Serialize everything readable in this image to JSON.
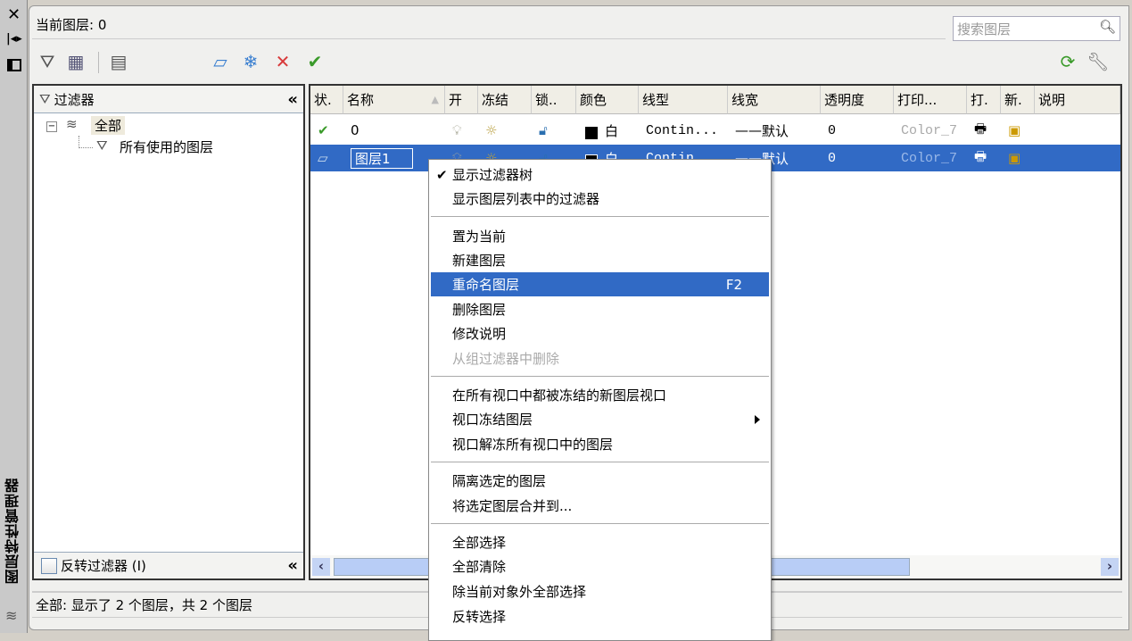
{
  "title": "图层特性管理器",
  "current_layer": "当前图层: 0",
  "search_placeholder": "搜索图层",
  "filter_panel": {
    "title": "过滤器",
    "tree": [
      {
        "label": "全部"
      },
      {
        "label": "所有使用的图层"
      }
    ],
    "invert_label": "反转过滤器 (I)",
    "invert_checked": false
  },
  "columns": [
    "状.",
    "名称",
    "开",
    "冻结",
    "锁..",
    "颜色",
    "线型",
    "线宽",
    "透明度",
    "打印...",
    "打.",
    "新.",
    "说明"
  ],
  "rows": [
    {
      "status": "current",
      "name": "0",
      "color": "白",
      "linetype": "Contin...",
      "lineweight": "默认",
      "transparency": "0",
      "plotstyle": "Color_7",
      "selected": false
    },
    {
      "status": "layer",
      "name": "图层1",
      "color": "白",
      "linetype": "Contin...",
      "lineweight": "默认",
      "transparency": "0",
      "plotstyle": "Color_7",
      "selected": true
    }
  ],
  "status_bar": "全部: 显示了 2 个图层，共 2 个图层",
  "context_menu": {
    "items": [
      {
        "label": "显示过滤器树",
        "checked": true
      },
      {
        "label": "显示图层列表中的过滤器"
      },
      {
        "label": "置为当前"
      },
      {
        "label": "新建图层"
      },
      {
        "label": "重命名图层",
        "shortcut": "F2",
        "highlighted": true
      },
      {
        "label": "删除图层"
      },
      {
        "label": "修改说明"
      },
      {
        "label": "从组过滤器中删除",
        "disabled": true
      },
      {
        "label": "在所有视口中都被冻结的新图层视口"
      },
      {
        "label": "视口冻结图层",
        "submenu": true
      },
      {
        "label": "视口解冻所有视口中的图层"
      },
      {
        "label": "隔离选定的图层"
      },
      {
        "label": "将选定图层合并到..."
      },
      {
        "label": "全部选择"
      },
      {
        "label": "全部清除"
      },
      {
        "label": "除当前对象外全部选择"
      },
      {
        "label": "反转选择"
      }
    ]
  },
  "colors": {
    "selection": "#316ac5",
    "accent_green": "#3a9a2a",
    "delete_red": "#d83a3a"
  }
}
